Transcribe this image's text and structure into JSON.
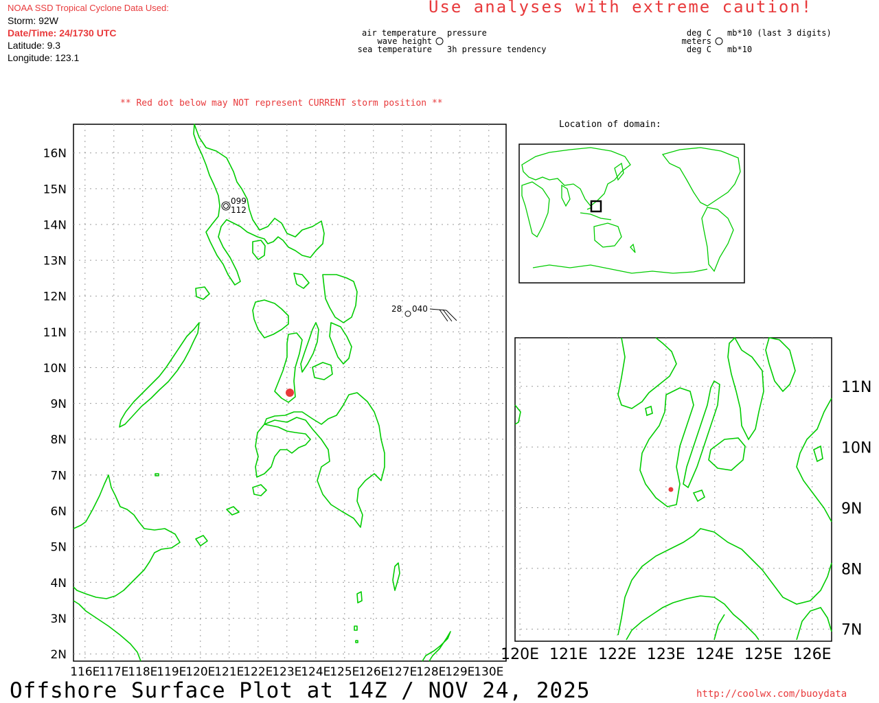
{
  "header": {
    "source_label": "NOAA SSD Tropical Cyclone Data Used:",
    "storm": "Storm: 92W",
    "datetime": "Date/Time: 24/1730 UTC",
    "latitude": "Latitude: 9.3",
    "longitude": "Longitude: 123.1"
  },
  "warning": "Use analyses with extreme caution!",
  "legend": {
    "left_col": [
      "air temperature",
      "wave height",
      "sea temperature"
    ],
    "right_col": [
      "pressure",
      "",
      "3h pressure tendency"
    ],
    "units_left": [
      "deg C",
      "meters",
      "deg C"
    ],
    "units_right": [
      "mb*10 (last 3 digits)",
      "",
      "mb*10"
    ]
  },
  "red_dot_note": "** Red dot below may NOT represent CURRENT storm position **",
  "inset_title": "Location of domain:",
  "main_map": {
    "lat_labels": [
      "16N",
      "15N",
      "14N",
      "13N",
      "12N",
      "11N",
      "10N",
      "9N",
      "8N",
      "7N",
      "6N",
      "5N",
      "4N",
      "3N",
      "2N"
    ],
    "lon_labels": [
      "116E",
      "117E",
      "118E",
      "119E",
      "120E",
      "121E",
      "122E",
      "123E",
      "124E",
      "125E",
      "126E",
      "127E",
      "128E",
      "129E",
      "130E"
    ],
    "lat_range": [
      1.8,
      16.8
    ],
    "lon_range": [
      115.6,
      130.6
    ]
  },
  "zoom_map": {
    "lat_labels": [
      "11N",
      "10N",
      "9N",
      "8N",
      "7N"
    ],
    "lon_labels": [
      "120E",
      "121E",
      "122E",
      "123E",
      "124E",
      "125E",
      "126E"
    ],
    "lat_range": [
      6.8,
      11.8
    ],
    "lon_range": [
      119.9,
      126.4
    ]
  },
  "storm_position": {
    "lat": 9.3,
    "lon": 123.1
  },
  "observations": [
    {
      "id": "buoy-1",
      "lat": 14.5,
      "lon": 120.8,
      "pressure": "099",
      "tendency": "112",
      "air_temp": "",
      "wind": ""
    },
    {
      "id": "buoy-2",
      "lat": 10.6,
      "lon": 127.3,
      "pressure": "040",
      "tendency": "",
      "air_temp": "28",
      "wind": "barb"
    }
  ],
  "colors": {
    "coast": "#00cc00",
    "storm_dot": "#e8393b",
    "warning": "#e8393b",
    "grid": "#999999"
  },
  "footer": "Offshore Surface Plot at 14Z / NOV 24, 2025",
  "url": "http://coolwx.com/buoydata"
}
